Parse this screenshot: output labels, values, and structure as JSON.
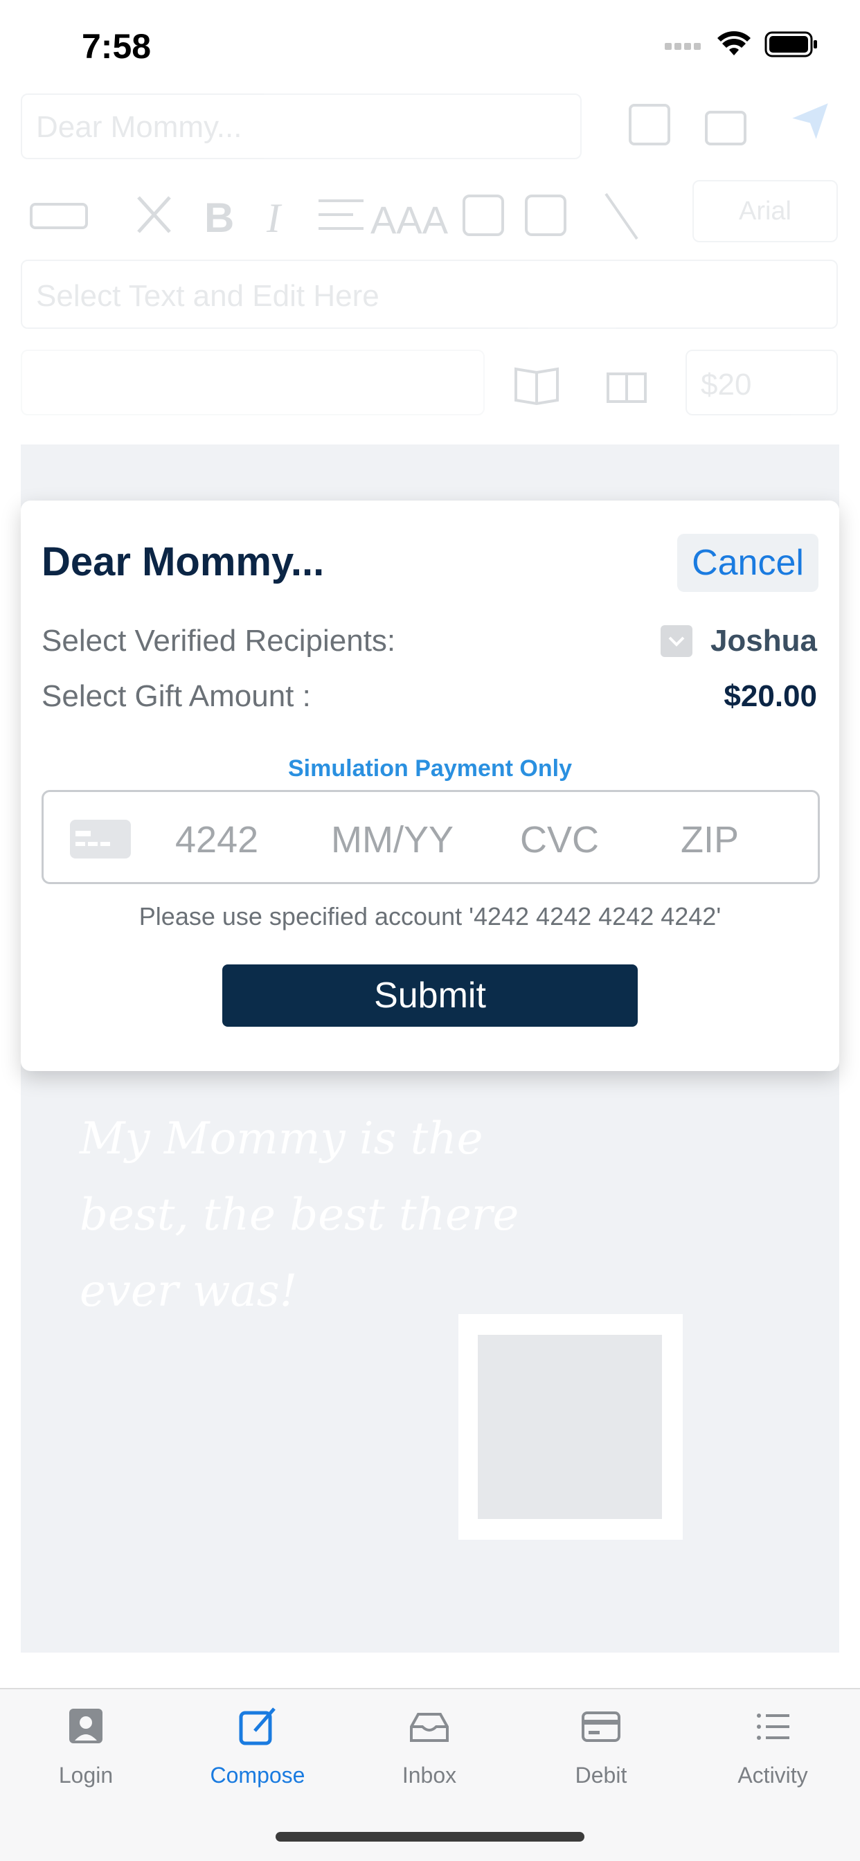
{
  "status": {
    "time": "7:58"
  },
  "background": {
    "title_placeholder": "Dear Mommy...",
    "font_name": "Arial",
    "edit_placeholder": "Select Text and Edit Here",
    "amount_placeholder": "$20",
    "card_message": "My Mommy is the best, the best there ever was!"
  },
  "modal": {
    "title": "Dear Mommy...",
    "cancel_label": "Cancel",
    "recipients_label": "Select Verified Recipients:",
    "recipient_name": "Joshua",
    "amount_label": "Select Gift Amount :",
    "amount_value": "$20.00",
    "simulation_label": "Simulation Payment Only",
    "card_number_placeholder": "4242",
    "expiry_placeholder": "MM/YY",
    "cvc_placeholder": "CVC",
    "zip_placeholder": "ZIP",
    "note": "Please use specified account '4242 4242 4242 4242'",
    "submit_label": "Submit"
  },
  "tabs": [
    {
      "label": "Login",
      "icon": "person-icon",
      "active": false
    },
    {
      "label": "Compose",
      "icon": "compose-icon",
      "active": true
    },
    {
      "label": "Inbox",
      "icon": "inbox-icon",
      "active": false
    },
    {
      "label": "Debit",
      "icon": "card-icon",
      "active": false
    },
    {
      "label": "Activity",
      "icon": "list-icon",
      "active": false
    }
  ],
  "colors": {
    "accent": "#1a7be0",
    "navy": "#0b2545",
    "submit_bg": "#0b2c4a",
    "simulation": "#2a90e0"
  }
}
